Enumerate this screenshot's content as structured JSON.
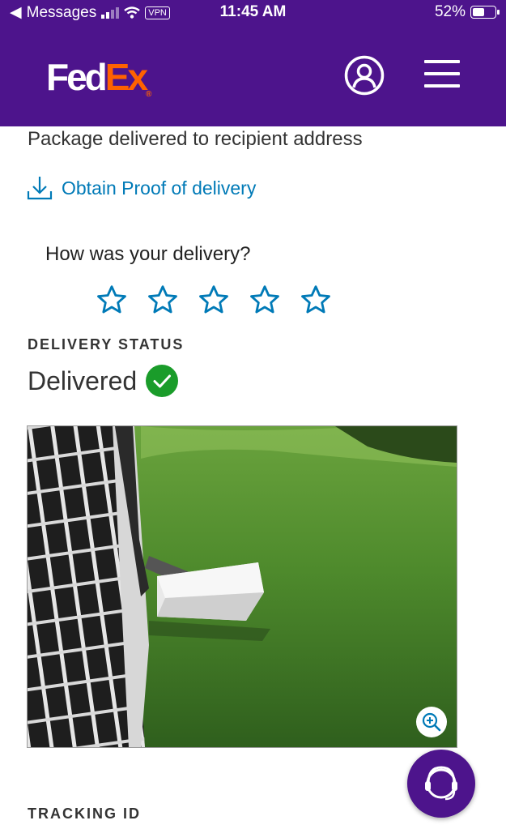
{
  "status_bar": {
    "back_label": "Messages",
    "vpn": "VPN",
    "time": "11:45 AM",
    "battery": "52%",
    "battery_level": 0.52
  },
  "header": {
    "logo_fed": "Fed",
    "logo_ex": "Ex",
    "logo_reg": "®",
    "account_icon": "user-circle-icon",
    "menu_icon": "hamburger-menu-icon"
  },
  "colors": {
    "brand_purple": "#4d148c",
    "brand_orange": "#ff6200",
    "link_blue": "#007ab7",
    "success_green": "#1a9c2a"
  },
  "delivery": {
    "message": "Package delivered to recipient address",
    "proof_link": "Obtain Proof of delivery",
    "proof_icon": "download-icon"
  },
  "rating": {
    "question": "How was your delivery?",
    "stars": 5,
    "selected": 0
  },
  "status": {
    "label": "DELIVERY STATUS",
    "value": "Delivered",
    "icon": "check-circle-icon"
  },
  "photo": {
    "zoom_icon": "zoom-in-icon"
  },
  "chat": {
    "icon": "chat-agent-icon"
  },
  "tracking": {
    "label": "TRACKING ID"
  }
}
